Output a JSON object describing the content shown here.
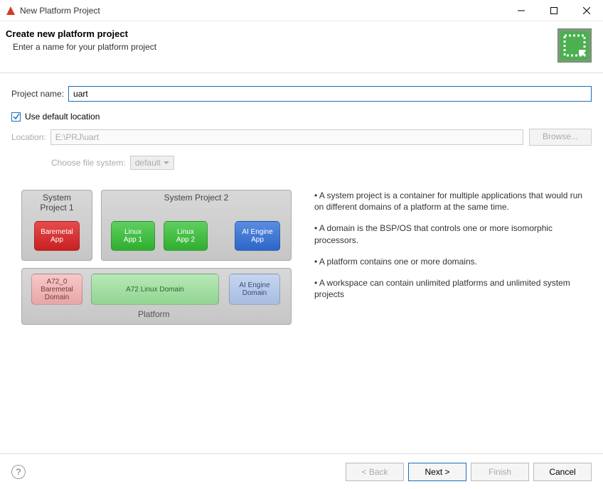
{
  "window": {
    "title": "New Platform Project"
  },
  "header": {
    "title": "Create new platform project",
    "subtitle": "Enter a name for your platform project"
  },
  "form": {
    "project_name_label": "Project name:",
    "project_name_value": "uart",
    "use_default_location_label": "Use default location",
    "use_default_location_checked": true,
    "location_label": "Location:",
    "location_value": "E:\\PRJ\\uart",
    "browse_label": "Browse...",
    "choose_fs_label": "Choose file system:",
    "choose_fs_value": "default"
  },
  "diagram": {
    "sys1_title": "System\nProject 1",
    "sys2_title": "System Project 2",
    "platform_title": "Platform",
    "chips": {
      "baremetal_app": "Baremetal\nApp",
      "linux_app1": "Linux\nApp 1",
      "linux_app2": "Linux\nApp 2",
      "ai_engine_app": "AI Engine\nApp",
      "a72_baremetal": "A72_0\nBaremetal\nDomain",
      "a72_linux": "A72 Linux Domain",
      "ai_engine_domain": "AI Engine\nDomain"
    }
  },
  "description": {
    "p1": "• A system project is a container for multiple applications that would run on different domains of a platform at the same time.",
    "p2": "• A domain is the BSP/OS that controls one or more isomorphic processors.",
    "p3": "• A platform contains one or more domains.",
    "p4": "• A workspace can contain unlimited platforms and unlimited system projects"
  },
  "footer": {
    "back": "< Back",
    "next": "Next >",
    "finish": "Finish",
    "cancel": "Cancel"
  }
}
